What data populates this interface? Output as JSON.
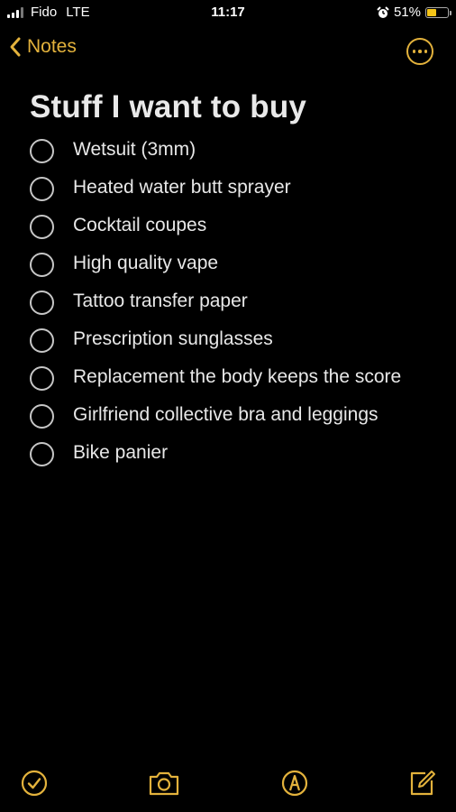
{
  "status_bar": {
    "carrier": "Fido",
    "network": "LTE",
    "time": "11:17",
    "battery_percent": "51%",
    "battery_level": 0.51,
    "alarm_icon": "alarm-clock-icon"
  },
  "nav": {
    "back_label": "Notes",
    "back_icon": "chevron-left-icon",
    "more_icon": "ellipsis-circle-icon"
  },
  "note": {
    "title": "Stuff I want to buy",
    "items": [
      {
        "text": "Wetsuit (3mm)",
        "checked": false
      },
      {
        "text": "Heated water butt sprayer",
        "checked": false
      },
      {
        "text": "Cocktail coupes",
        "checked": false
      },
      {
        "text": "High quality vape",
        "checked": false
      },
      {
        "text": "Tattoo transfer paper",
        "checked": false
      },
      {
        "text": "Prescription sunglasses",
        "checked": false
      },
      {
        "text": "Replacement the body keeps the score",
        "checked": false
      },
      {
        "text": "Girlfriend collective bra and leggings",
        "checked": false
      },
      {
        "text": "Bike panier",
        "checked": false
      }
    ]
  },
  "toolbar": {
    "icons": [
      "checklist-icon",
      "camera-icon",
      "markup-icon",
      "compose-icon"
    ]
  },
  "colors": {
    "accent": "#e3b23c",
    "background": "#000000",
    "text": "#e8e8e8"
  }
}
